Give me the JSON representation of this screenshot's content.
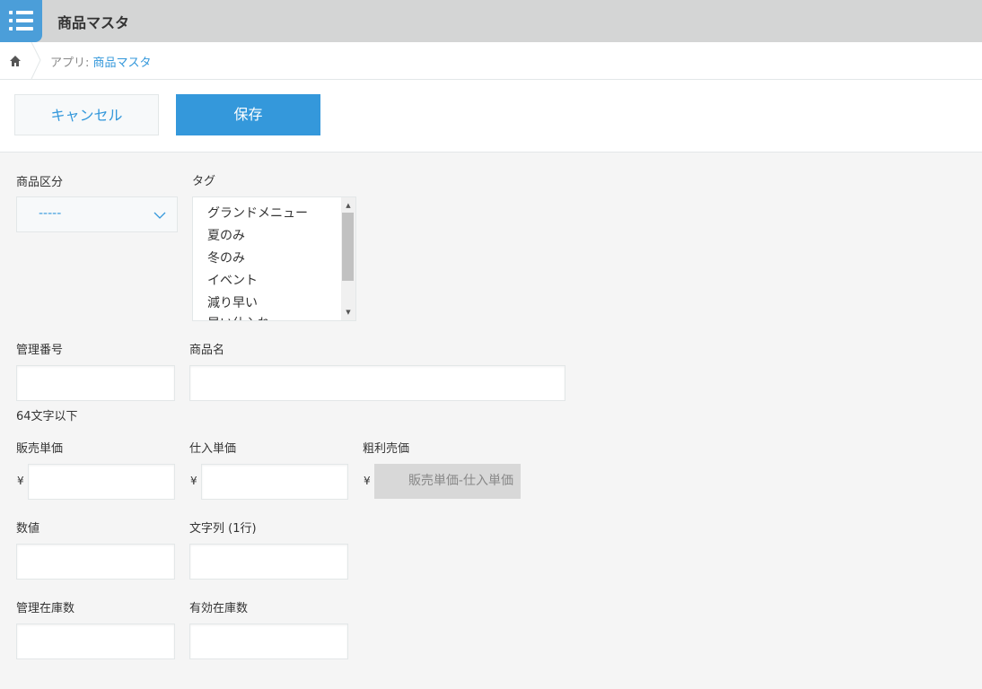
{
  "app": {
    "title": "商品マスタ"
  },
  "breadcrumb": {
    "prefix": "アプリ: ",
    "current": "商品マスタ"
  },
  "toolbar": {
    "cancel_label": "キャンセル",
    "save_label": "保存"
  },
  "form": {
    "category": {
      "label": "商品区分",
      "value": "-----"
    },
    "tags": {
      "label": "タグ",
      "options": [
        "グランドメニュー",
        "夏のみ",
        "冬のみ",
        "イベント",
        "減り早い",
        "早い仕入れ"
      ]
    },
    "management_no": {
      "label": "管理番号",
      "value": "",
      "hint": "64文字以下"
    },
    "product_name": {
      "label": "商品名",
      "value": ""
    },
    "sale_price": {
      "label": "販売単価",
      "currency": "¥",
      "value": ""
    },
    "purchase_price": {
      "label": "仕入単価",
      "currency": "¥",
      "value": ""
    },
    "gross_profit": {
      "label": "粗利売価",
      "currency": "¥",
      "formula": "販売単価-仕入単価"
    },
    "number": {
      "label": "数値",
      "value": ""
    },
    "text_single": {
      "label": "文字列 (1行)",
      "value": ""
    },
    "managed_stock": {
      "label": "管理在庫数",
      "value": ""
    },
    "effective_stock": {
      "label": "有効在庫数",
      "value": ""
    }
  },
  "colors": {
    "accent": "#3498db",
    "header_bg": "#d4d5d5",
    "page_bg": "#f5f5f5",
    "icon_bg": "#4b9ed9"
  }
}
